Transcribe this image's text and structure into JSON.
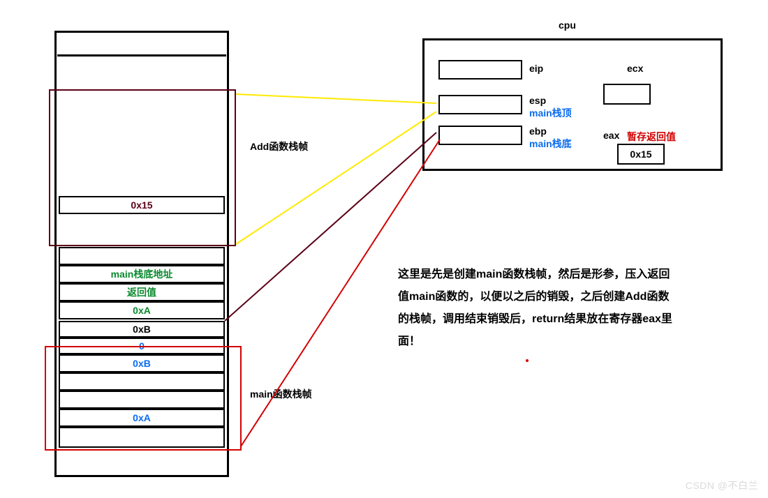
{
  "cpu": {
    "title": "cpu",
    "eip": {
      "label": "eip"
    },
    "esp": {
      "label": "esp",
      "note": "main栈顶"
    },
    "ebp": {
      "label": "ebp",
      "note": "main栈底"
    },
    "ecx": {
      "label": "ecx"
    },
    "eax": {
      "label": "eax",
      "note": "暂存返回值",
      "value": "0x15"
    }
  },
  "stack": {
    "cell_0x15": "0x15",
    "cell_main_base": "main栈底地址",
    "cell_return": "返回值",
    "cell_0xA_green": "0xA",
    "cell_0xB_black": "0xB",
    "cell_0_blue": "0",
    "cell_0xB_blue": "0xB",
    "cell_0xA_blue": "0xA"
  },
  "labels": {
    "add_frame": "Add函数栈帧",
    "main_frame": "main函数栈帧"
  },
  "paragraph": "这里是先是创建main函数栈帧，然后是形参，压入返回值main函数的，以便以之后的销毁，之后创建Add函数的栈帧，调用结束销毁后，return结果放在寄存器eax里面！",
  "watermark": "CSDN @不白兰"
}
